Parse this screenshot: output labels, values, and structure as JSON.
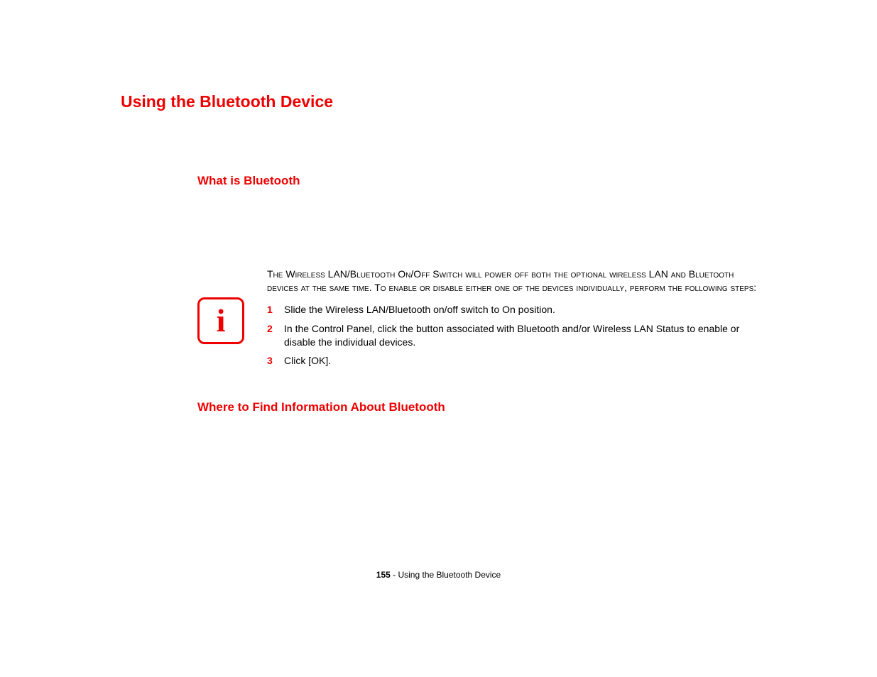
{
  "title": "Using the Bluetooth Device",
  "sections": {
    "what_is": "What is Bluetooth",
    "where_find": "Where to Find Information About Bluetooth"
  },
  "info": {
    "intro": "The Wireless LAN/Bluetooth On/Off Switch will power off both the optional wireless LAN and Bluetooth devices at the same time. To enable or disable either one of the devices individually, perform the following steps:",
    "steps": [
      {
        "n": "1",
        "text": "Slide the Wireless LAN/Bluetooth on/off switch to On position."
      },
      {
        "n": "2",
        "text": "In the Control Panel, click the button associated with Bluetooth and/or Wireless LAN Status to enable or disable the individual devices."
      },
      {
        "n": "3",
        "text": "Click [OK]."
      }
    ]
  },
  "footer": {
    "page": "155",
    "sep": " - ",
    "label": "Using the Bluetooth Device"
  }
}
